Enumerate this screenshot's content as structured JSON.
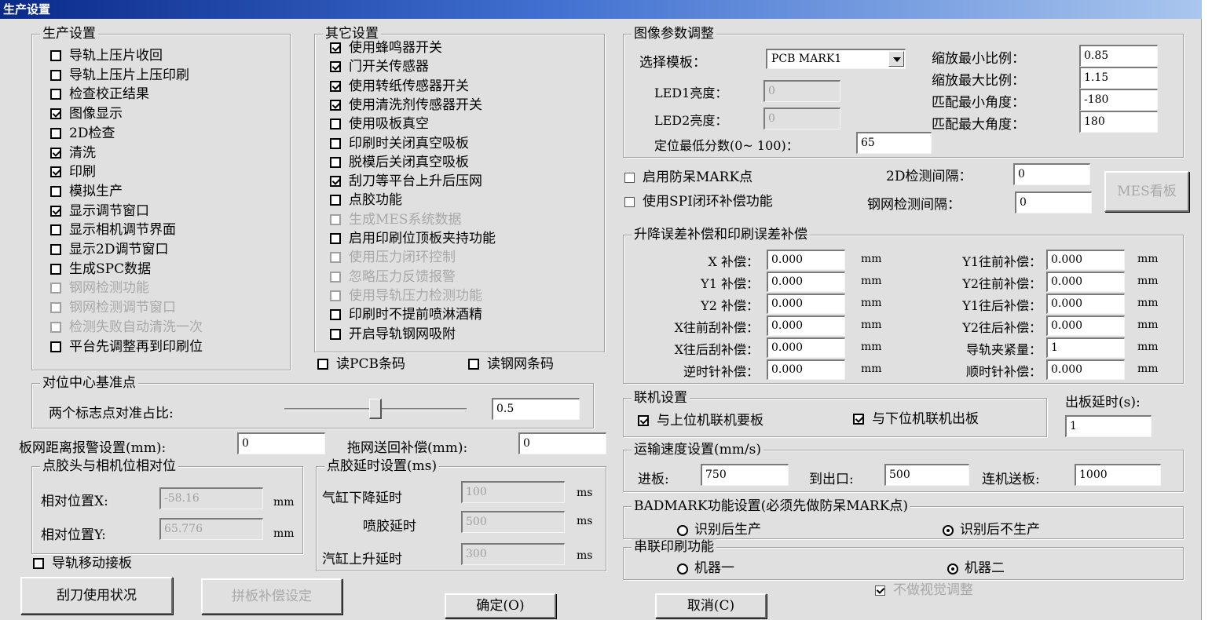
{
  "window": {
    "title": "生产设置"
  },
  "production": {
    "title": "生产设置",
    "items": [
      {
        "label": "导轨上压片收回",
        "checked": false,
        "disabled": false
      },
      {
        "label": "导轨上压片上压印刷",
        "checked": false,
        "disabled": false
      },
      {
        "label": "检查校正结果",
        "checked": false,
        "disabled": false
      },
      {
        "label": "图像显示",
        "checked": true,
        "disabled": false
      },
      {
        "label": "2D检查",
        "checked": false,
        "disabled": false
      },
      {
        "label": "清洗",
        "checked": true,
        "disabled": false
      },
      {
        "label": "印刷",
        "checked": true,
        "disabled": false
      },
      {
        "label": "模拟生产",
        "checked": false,
        "disabled": false
      },
      {
        "label": "显示调节窗口",
        "checked": true,
        "disabled": false
      },
      {
        "label": "显示相机调节界面",
        "checked": false,
        "disabled": false
      },
      {
        "label": "显示2D调节窗口",
        "checked": false,
        "disabled": false
      },
      {
        "label": "生成SPC数据",
        "checked": false,
        "disabled": false
      },
      {
        "label": "钢网检测功能",
        "checked": false,
        "disabled": true
      },
      {
        "label": "钢网检测调节窗口",
        "checked": false,
        "disabled": true
      },
      {
        "label": "检测失败自动清洗一次",
        "checked": false,
        "disabled": true
      },
      {
        "label": "平台先调整再到印刷位",
        "checked": false,
        "disabled": false
      }
    ]
  },
  "other": {
    "title": "其它设置",
    "items": [
      {
        "label": "使用蜂鸣器开关",
        "checked": true,
        "disabled": false
      },
      {
        "label": "门开关传感器",
        "checked": true,
        "disabled": false
      },
      {
        "label": "使用转纸传感器开关",
        "checked": true,
        "disabled": false
      },
      {
        "label": "使用清洗剂传感器开关",
        "checked": true,
        "disabled": false
      },
      {
        "label": "使用吸板真空",
        "checked": false,
        "disabled": false
      },
      {
        "label": "印刷时关闭真空吸板",
        "checked": false,
        "disabled": false
      },
      {
        "label": "脱模后关闭真空吸板",
        "checked": false,
        "disabled": false
      },
      {
        "label": "刮刀等平台上升后压网",
        "checked": true,
        "disabled": false
      },
      {
        "label": "点胶功能",
        "checked": false,
        "disabled": false
      },
      {
        "label": "生成MES系统数据",
        "checked": false,
        "disabled": true
      },
      {
        "label": "启用印刷位顶板夹持功能",
        "checked": false,
        "disabled": false
      },
      {
        "label": "使用压力闭环控制",
        "checked": false,
        "disabled": true
      },
      {
        "label": "忽略压力反馈报警",
        "checked": false,
        "disabled": true
      },
      {
        "label": "使用导轨压力检测功能",
        "checked": false,
        "disabled": true
      },
      {
        "label": "印刷时不提前喷淋酒精",
        "checked": false,
        "disabled": false
      },
      {
        "label": "开启导轨钢网吸附",
        "checked": false,
        "disabled": false
      }
    ],
    "read_pcb_barcode": "读PCB条码",
    "read_stencil_barcode": "读钢网条码"
  },
  "image_params": {
    "title": "图像参数调整",
    "template_label": "选择模板：",
    "template_value": "PCB MARK1",
    "led1_label": "LED1亮度：",
    "led1_value": "0",
    "led2_label": "LED2亮度：",
    "led2_value": "0",
    "min_score_label": "定位最低分数(0~ 100)：",
    "min_score_value": "65",
    "scale_min_label": "缩放最小比例：",
    "scale_min_value": "0.85",
    "scale_max_label": "缩放最大比例：",
    "scale_max_value": "1.15",
    "angle_min_label": "匹配最小角度：",
    "angle_min_value": "-180",
    "angle_max_label": "匹配最大角度：",
    "angle_max_value": "180"
  },
  "misc": {
    "anti_mark_label": "启用防呆MARK点",
    "spi_label": "使用SPI闭环补偿功能",
    "inspect2d_label": "2D检测间隔：",
    "inspect2d_value": "0",
    "stencil_interval_label": "钢网检测间隔：",
    "stencil_interval_value": "0",
    "mes_button": "MES看板"
  },
  "compensation": {
    "title": "升降误差补偿和印刷误差补偿",
    "unit": "mm",
    "left": [
      {
        "label": "X 补偿：",
        "value": "0.000"
      },
      {
        "label": "Y1 补偿：",
        "value": "0.000"
      },
      {
        "label": "Y2 补偿：",
        "value": "0.000"
      },
      {
        "label": "X往前刮补偿：",
        "value": "0.000"
      },
      {
        "label": "X往后刮补偿：",
        "value": "0.000"
      },
      {
        "label": "逆时针补偿：",
        "value": "0.000"
      }
    ],
    "right": [
      {
        "label": "Y1往前补偿：",
        "value": "0.000"
      },
      {
        "label": "Y2往前补偿：",
        "value": "0.000"
      },
      {
        "label": "Y1往后补偿：",
        "value": "0.000"
      },
      {
        "label": "Y2往后补偿：",
        "value": "0.000"
      },
      {
        "label": "导轨夹紧量：",
        "value": "1"
      },
      {
        "label": "顺时针补偿：",
        "value": "0.000"
      }
    ]
  },
  "link": {
    "title": "联机设置",
    "upstream_label": "与上位机联机要板",
    "downstream_label": "与下位机联机出板",
    "out_delay_label": "出板延时(s):",
    "out_delay_value": "1"
  },
  "speed": {
    "title": "运输速度设置(mm/s)",
    "in_label": "进板:",
    "in_value": "750",
    "exit_label": "到出口:",
    "exit_value": "500",
    "link_label": "连机送板:",
    "link_value": "1000"
  },
  "badmark": {
    "title": "BADMARK功能设置(必须先做防呆MARK点)",
    "opt1": "识别后生产",
    "opt2": "识别后不生产",
    "selected": "识别后不生产"
  },
  "serial": {
    "title": "串联印刷功能",
    "opt1": "机器一",
    "opt2": "机器二",
    "selected": "机器二"
  },
  "no_visual": "不做视觉调整",
  "alignment": {
    "title": "对位中心基准点",
    "ratio_label": "两个标志点对准占比:",
    "ratio_value": "0.5",
    "slider_fraction": 0.5
  },
  "board_gap": {
    "label": "板网距离报警设置(mm):",
    "value": "0",
    "drag_label": "拖网送回补偿(mm):",
    "drag_value": "0"
  },
  "glue_pos": {
    "title": "点胶头与相机位相对位",
    "x_label": "相对位置X:",
    "x_value": "-58.16",
    "y_label": "相对位置Y:",
    "y_value": "65.776",
    "unit": "mm"
  },
  "glue_delay": {
    "title": "点胶延时设置(ms)",
    "down_label": "气缸下降延时",
    "down_value": "100",
    "spray_label": "喷胶延时",
    "spray_value": "500",
    "up_label": "汽缸上升延时",
    "up_value": "300",
    "unit": "ms"
  },
  "rail_move": "导轨移动接板",
  "buttons": {
    "blade": "刮刀使用状况",
    "splice": "拼板补偿设定",
    "ok": "确定(O)",
    "cancel": "取消(C)"
  }
}
